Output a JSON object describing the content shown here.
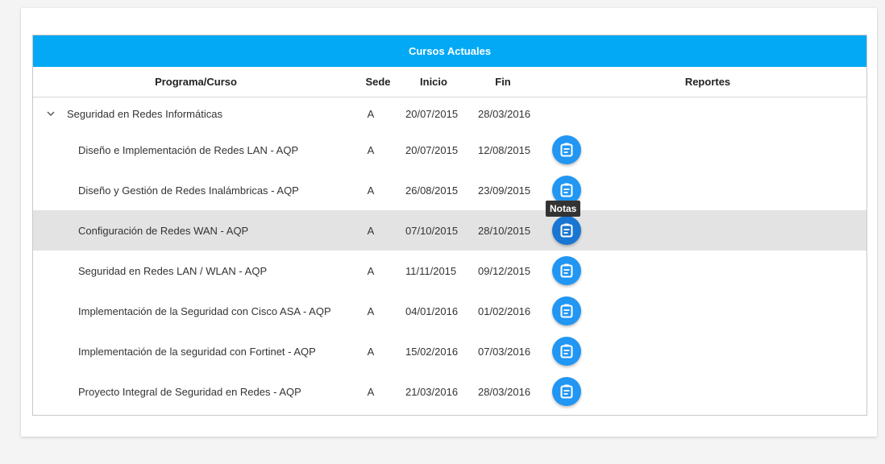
{
  "table": {
    "title": "Cursos Actuales",
    "headers": {
      "program": "Programa/Curso",
      "sede": "Sede",
      "inicio": "Inicio",
      "fin": "Fin",
      "reportes": "Reportes"
    },
    "group": {
      "program": "Seguridad en Redes Informáticas",
      "sede": "A",
      "inicio": "20/07/2015",
      "fin": "28/03/2016",
      "expanded": true
    },
    "rows": [
      {
        "program": "Diseño e Implementación de Redes LAN - AQP",
        "sede": "A",
        "inicio": "20/07/2015",
        "fin": "12/08/2015"
      },
      {
        "program": "Diseño y Gestión de Redes Inalámbricas - AQP",
        "sede": "A",
        "inicio": "26/08/2015",
        "fin": "23/09/2015"
      },
      {
        "program": "Configuración de Redes WAN - AQP",
        "sede": "A",
        "inicio": "07/10/2015",
        "fin": "28/10/2015"
      },
      {
        "program": "Seguridad en Redes LAN / WLAN - AQP",
        "sede": "A",
        "inicio": "11/11/2015",
        "fin": "09/12/2015"
      },
      {
        "program": "Implementación de la Seguridad con Cisco ASA - AQP",
        "sede": "A",
        "inicio": "04/01/2016",
        "fin": "01/02/2016"
      },
      {
        "program": "Implementación de la seguridad con Fortinet - AQP",
        "sede": "A",
        "inicio": "15/02/2016",
        "fin": "07/03/2016"
      },
      {
        "program": "Proyecto Integral de Seguridad en Redes - AQP",
        "sede": "A",
        "inicio": "21/03/2016",
        "fin": "28/03/2016"
      }
    ],
    "selected_row_index": 2
  },
  "tooltip": {
    "text": "Notas"
  },
  "icons": {
    "toggle": "chevron-down-icon",
    "notes": "notes-icon"
  },
  "colors": {
    "title_bar": "#03a9f4",
    "button": "#2196f3",
    "button_active": "#1976d2",
    "selected_row": "#e3e3e3"
  }
}
